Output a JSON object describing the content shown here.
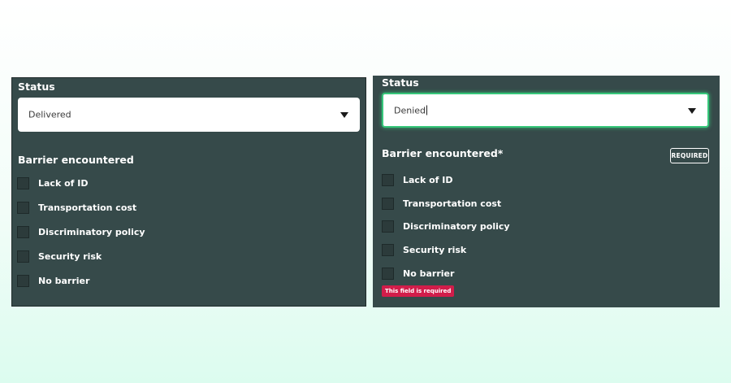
{
  "left_form": {
    "status_label": "Status",
    "status_value": "Delivered",
    "barrier_label": "Barrier encountered",
    "options": [
      {
        "label": "Lack of ID",
        "checked": false
      },
      {
        "label": "Transportation cost",
        "checked": false
      },
      {
        "label": "Discriminatory policy",
        "checked": false
      },
      {
        "label": "Security risk",
        "checked": false
      },
      {
        "label": "No barrier",
        "checked": false
      }
    ]
  },
  "right_form": {
    "status_label": "Status",
    "status_value": "Denied",
    "barrier_label": "Barrier encountered*",
    "required_badge": "REQUIRED",
    "options": [
      {
        "label": "Lack of ID",
        "checked": false
      },
      {
        "label": "Transportation cost",
        "checked": false
      },
      {
        "label": "Discriminatory policy",
        "checked": false
      },
      {
        "label": "Security risk",
        "checked": false
      },
      {
        "label": "No barrier",
        "checked": false
      }
    ],
    "error_message": "This field is required"
  },
  "colors": {
    "panel_bg": "#364a4a",
    "focus_border": "#36c77a",
    "error_bg": "#d11d4a"
  },
  "icons": [
    "chevron-down-icon"
  ]
}
